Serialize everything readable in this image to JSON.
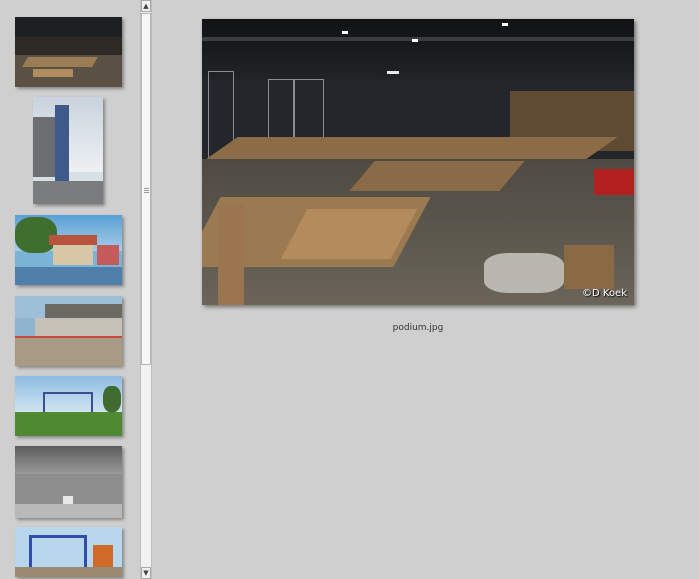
{
  "gallery": {
    "thumbnails": [
      {
        "subject": "hall interior"
      },
      {
        "subject": "tower building"
      },
      {
        "subject": "houses by water"
      },
      {
        "subject": "construction frame"
      },
      {
        "subject": "steel structure field"
      },
      {
        "subject": "hall roof interior"
      },
      {
        "subject": "blue steel frame crane"
      }
    ]
  },
  "viewer": {
    "watermark": "©D Koek",
    "caption": "podium.jpg"
  },
  "scrollbar": {
    "up_icon": "▲",
    "down_icon": "▼"
  }
}
